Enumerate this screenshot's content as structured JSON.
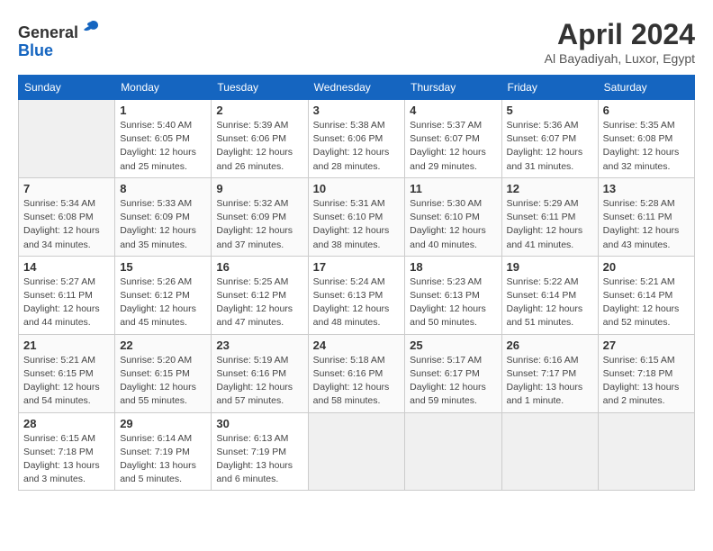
{
  "header": {
    "logo_line1": "General",
    "logo_line2": "Blue",
    "month_title": "April 2024",
    "location": "Al Bayadiyah, Luxor, Egypt"
  },
  "days_of_week": [
    "Sunday",
    "Monday",
    "Tuesday",
    "Wednesday",
    "Thursday",
    "Friday",
    "Saturday"
  ],
  "weeks": [
    [
      {
        "day": "",
        "info": ""
      },
      {
        "day": "1",
        "info": "Sunrise: 5:40 AM\nSunset: 6:05 PM\nDaylight: 12 hours\nand 25 minutes."
      },
      {
        "day": "2",
        "info": "Sunrise: 5:39 AM\nSunset: 6:06 PM\nDaylight: 12 hours\nand 26 minutes."
      },
      {
        "day": "3",
        "info": "Sunrise: 5:38 AM\nSunset: 6:06 PM\nDaylight: 12 hours\nand 28 minutes."
      },
      {
        "day": "4",
        "info": "Sunrise: 5:37 AM\nSunset: 6:07 PM\nDaylight: 12 hours\nand 29 minutes."
      },
      {
        "day": "5",
        "info": "Sunrise: 5:36 AM\nSunset: 6:07 PM\nDaylight: 12 hours\nand 31 minutes."
      },
      {
        "day": "6",
        "info": "Sunrise: 5:35 AM\nSunset: 6:08 PM\nDaylight: 12 hours\nand 32 minutes."
      }
    ],
    [
      {
        "day": "7",
        "info": "Sunrise: 5:34 AM\nSunset: 6:08 PM\nDaylight: 12 hours\nand 34 minutes."
      },
      {
        "day": "8",
        "info": "Sunrise: 5:33 AM\nSunset: 6:09 PM\nDaylight: 12 hours\nand 35 minutes."
      },
      {
        "day": "9",
        "info": "Sunrise: 5:32 AM\nSunset: 6:09 PM\nDaylight: 12 hours\nand 37 minutes."
      },
      {
        "day": "10",
        "info": "Sunrise: 5:31 AM\nSunset: 6:10 PM\nDaylight: 12 hours\nand 38 minutes."
      },
      {
        "day": "11",
        "info": "Sunrise: 5:30 AM\nSunset: 6:10 PM\nDaylight: 12 hours\nand 40 minutes."
      },
      {
        "day": "12",
        "info": "Sunrise: 5:29 AM\nSunset: 6:11 PM\nDaylight: 12 hours\nand 41 minutes."
      },
      {
        "day": "13",
        "info": "Sunrise: 5:28 AM\nSunset: 6:11 PM\nDaylight: 12 hours\nand 43 minutes."
      }
    ],
    [
      {
        "day": "14",
        "info": "Sunrise: 5:27 AM\nSunset: 6:11 PM\nDaylight: 12 hours\nand 44 minutes."
      },
      {
        "day": "15",
        "info": "Sunrise: 5:26 AM\nSunset: 6:12 PM\nDaylight: 12 hours\nand 45 minutes."
      },
      {
        "day": "16",
        "info": "Sunrise: 5:25 AM\nSunset: 6:12 PM\nDaylight: 12 hours\nand 47 minutes."
      },
      {
        "day": "17",
        "info": "Sunrise: 5:24 AM\nSunset: 6:13 PM\nDaylight: 12 hours\nand 48 minutes."
      },
      {
        "day": "18",
        "info": "Sunrise: 5:23 AM\nSunset: 6:13 PM\nDaylight: 12 hours\nand 50 minutes."
      },
      {
        "day": "19",
        "info": "Sunrise: 5:22 AM\nSunset: 6:14 PM\nDaylight: 12 hours\nand 51 minutes."
      },
      {
        "day": "20",
        "info": "Sunrise: 5:21 AM\nSunset: 6:14 PM\nDaylight: 12 hours\nand 52 minutes."
      }
    ],
    [
      {
        "day": "21",
        "info": "Sunrise: 5:21 AM\nSunset: 6:15 PM\nDaylight: 12 hours\nand 54 minutes."
      },
      {
        "day": "22",
        "info": "Sunrise: 5:20 AM\nSunset: 6:15 PM\nDaylight: 12 hours\nand 55 minutes."
      },
      {
        "day": "23",
        "info": "Sunrise: 5:19 AM\nSunset: 6:16 PM\nDaylight: 12 hours\nand 57 minutes."
      },
      {
        "day": "24",
        "info": "Sunrise: 5:18 AM\nSunset: 6:16 PM\nDaylight: 12 hours\nand 58 minutes."
      },
      {
        "day": "25",
        "info": "Sunrise: 5:17 AM\nSunset: 6:17 PM\nDaylight: 12 hours\nand 59 minutes."
      },
      {
        "day": "26",
        "info": "Sunrise: 6:16 AM\nSunset: 7:17 PM\nDaylight: 13 hours\nand 1 minute."
      },
      {
        "day": "27",
        "info": "Sunrise: 6:15 AM\nSunset: 7:18 PM\nDaylight: 13 hours\nand 2 minutes."
      }
    ],
    [
      {
        "day": "28",
        "info": "Sunrise: 6:15 AM\nSunset: 7:18 PM\nDaylight: 13 hours\nand 3 minutes."
      },
      {
        "day": "29",
        "info": "Sunrise: 6:14 AM\nSunset: 7:19 PM\nDaylight: 13 hours\nand 5 minutes."
      },
      {
        "day": "30",
        "info": "Sunrise: 6:13 AM\nSunset: 7:19 PM\nDaylight: 13 hours\nand 6 minutes."
      },
      {
        "day": "",
        "info": ""
      },
      {
        "day": "",
        "info": ""
      },
      {
        "day": "",
        "info": ""
      },
      {
        "day": "",
        "info": ""
      }
    ]
  ]
}
